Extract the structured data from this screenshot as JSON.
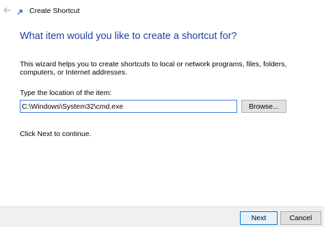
{
  "window": {
    "title": "Create Shortcut",
    "back_icon": "back-arrow-icon",
    "app_icon": "shortcut-wizard-icon"
  },
  "main": {
    "heading": "What item would you like to create a shortcut for?",
    "description": "This wizard helps you to create shortcuts to local or network programs, files, folders, computers, or Internet addresses.",
    "location_label": "Type the location of the item:",
    "location_value": "C:\\Windows\\System32\\cmd.exe",
    "browse_label": "Browse...",
    "hint": "Click Next to continue."
  },
  "footer": {
    "next_label": "Next",
    "cancel_label": "Cancel"
  },
  "colors": {
    "heading": "#1e3f9c",
    "accent": "#0078d7",
    "footer_bg": "#f0f0f0"
  }
}
